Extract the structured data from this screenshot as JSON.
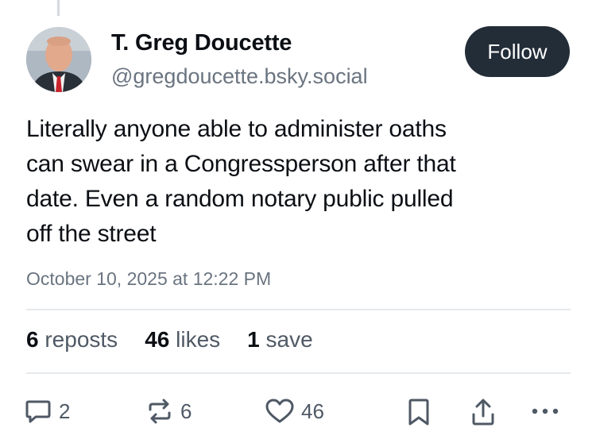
{
  "author": {
    "name": "T. Greg Doucette",
    "handle": "@gregdoucette.bsky.social"
  },
  "follow_label": "Follow",
  "post": {
    "text": "Literally anyone able to administer oaths\ncan swear in a Congressperson after that\ndate. Even a random notary public pulled\noff the street",
    "timestamp": "October 10, 2025 at 12:22 PM"
  },
  "stats": {
    "reposts_count": "6",
    "reposts_label": "reposts",
    "likes_count": "46",
    "likes_label": "likes",
    "saves_count": "1",
    "saves_label": "save"
  },
  "actions": {
    "reply_count": "2",
    "repost_count": "6",
    "like_count": "46"
  },
  "colors": {
    "follow_bg": "#232d38",
    "muted_text": "#6a7480",
    "icon": "#4f5965"
  },
  "icons": [
    "reply-icon",
    "repost-icon",
    "heart-icon",
    "bookmark-icon",
    "share-icon",
    "more-icon"
  ]
}
